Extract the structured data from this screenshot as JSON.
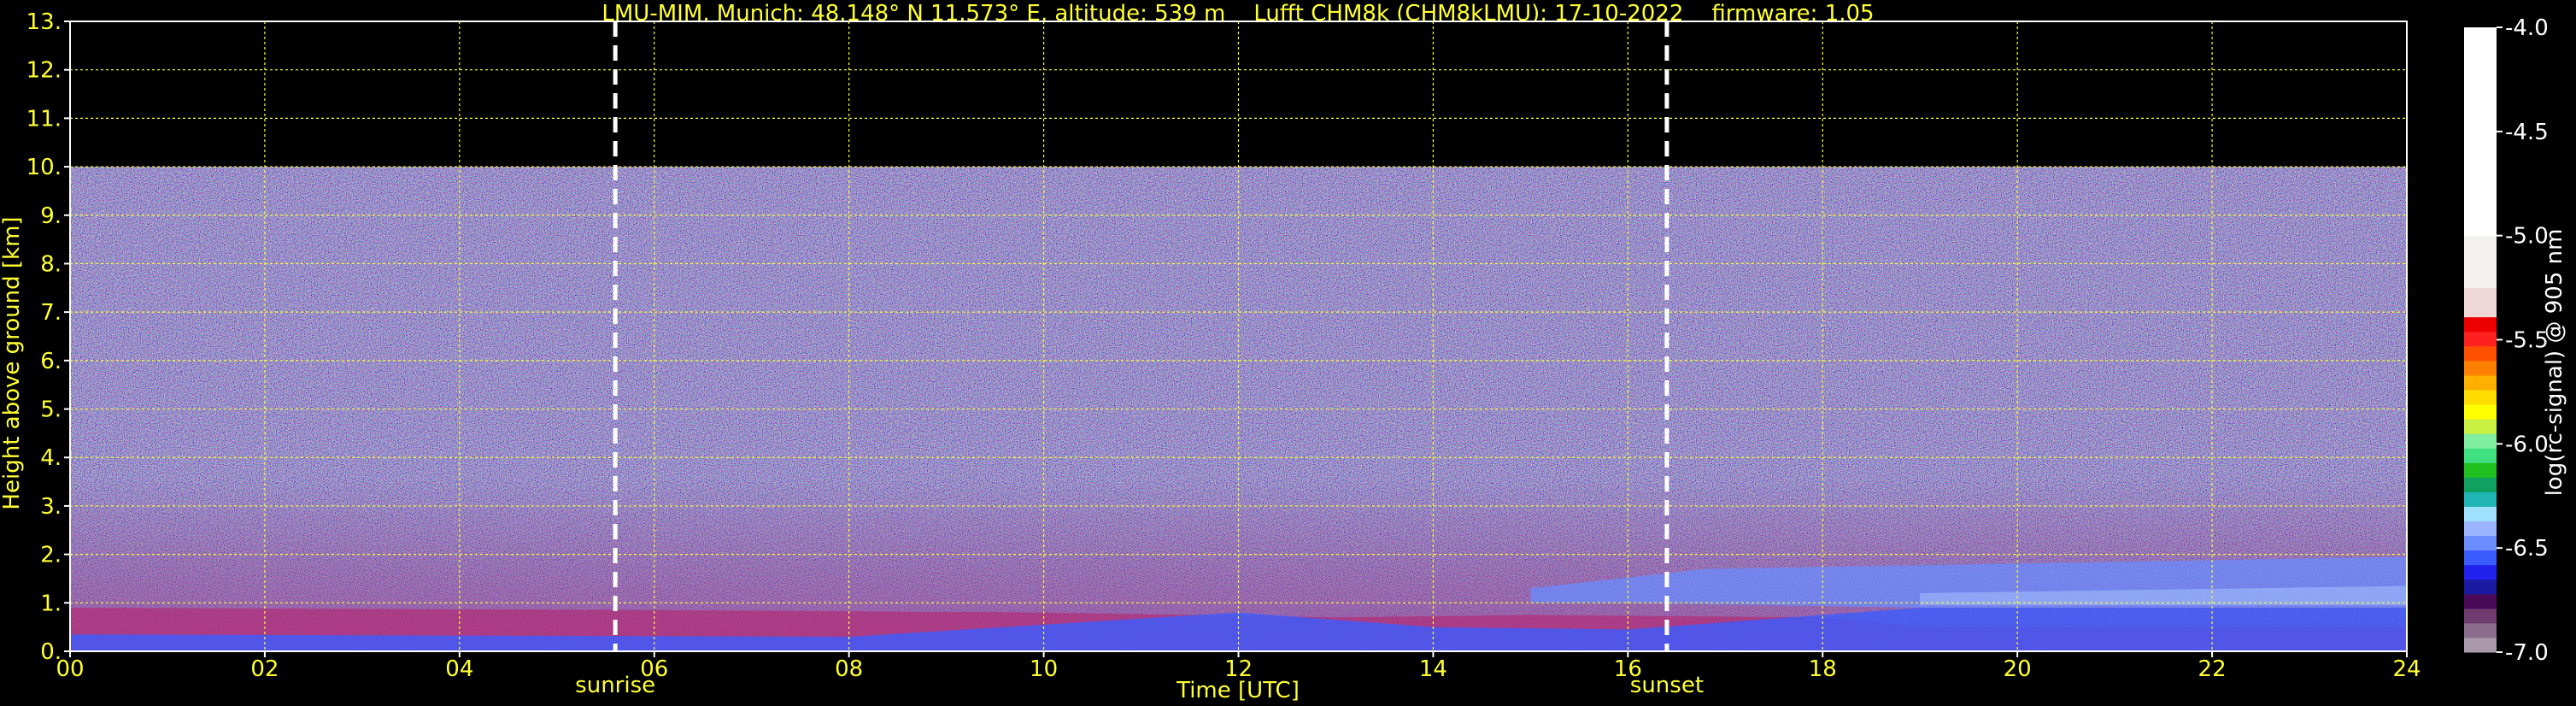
{
  "chart_data": {
    "type": "heatmap",
    "title": "LMU-MIM, Munich; 48.148° N 11.573° E, altitude: 539 m    Lufft CHM8k (CHM8kLMU): 17-10-2022    firmware: 1.05",
    "xlabel": "Time [UTC]",
    "ylabel": "Height above ground [km]",
    "xlim": [
      0,
      24
    ],
    "ylim": [
      0,
      13
    ],
    "x_ticks": [
      "00",
      "02",
      "04",
      "06",
      "08",
      "10",
      "12",
      "14",
      "16",
      "18",
      "20",
      "22",
      "24"
    ],
    "y_ticks": [
      "0.",
      "1.",
      "2.",
      "3.",
      "4.",
      "5.",
      "6.",
      "7.",
      "8.",
      "9.",
      "10.",
      "11.",
      "12.",
      "13."
    ],
    "grid": true,
    "data_max_height_km": 10,
    "events": [
      {
        "label": "sunrise",
        "time_h": 5.6
      },
      {
        "label": "sunset",
        "time_h": 16.4
      }
    ],
    "colorbar": {
      "label": "log(rc-signal) @ 905 nm",
      "range": [
        -7.0,
        -4.0
      ],
      "ticks": [
        "-4.0",
        "-4.5",
        "-5.0",
        "-5.5",
        "-6.0",
        "-6.5",
        "-7.0"
      ],
      "colors": [
        {
          "from": -7.0,
          "to": -6.93,
          "color": "#aa99aa"
        },
        {
          "from": -6.93,
          "to": -6.86,
          "color": "#8c6c8c"
        },
        {
          "from": -6.86,
          "to": -6.79,
          "color": "#6e3c6e"
        },
        {
          "from": -6.79,
          "to": -6.72,
          "color": "#4a0a5a"
        },
        {
          "from": -6.72,
          "to": -6.65,
          "color": "#1a1aa0"
        },
        {
          "from": -6.65,
          "to": -6.58,
          "color": "#2222ee"
        },
        {
          "from": -6.58,
          "to": -6.51,
          "color": "#3a5cff"
        },
        {
          "from": -6.51,
          "to": -6.44,
          "color": "#6a8cff"
        },
        {
          "from": -6.44,
          "to": -6.37,
          "color": "#9ab4ff"
        },
        {
          "from": -6.37,
          "to": -6.3,
          "color": "#a0e0ff"
        },
        {
          "from": -6.3,
          "to": -6.23,
          "color": "#20b4b4"
        },
        {
          "from": -6.23,
          "to": -6.16,
          "color": "#10a060"
        },
        {
          "from": -6.16,
          "to": -6.09,
          "color": "#20c020"
        },
        {
          "from": -6.09,
          "to": -6.02,
          "color": "#40e080"
        },
        {
          "from": -6.02,
          "to": -5.95,
          "color": "#80f0a0"
        },
        {
          "from": -5.95,
          "to": -5.88,
          "color": "#c8f040"
        },
        {
          "from": -5.88,
          "to": -5.81,
          "color": "#ffff00"
        },
        {
          "from": -5.81,
          "to": -5.74,
          "color": "#ffdd00"
        },
        {
          "from": -5.74,
          "to": -5.67,
          "color": "#ffb000"
        },
        {
          "from": -5.67,
          "to": -5.6,
          "color": "#ff8000"
        },
        {
          "from": -5.6,
          "to": -5.53,
          "color": "#ff5000"
        },
        {
          "from": -5.53,
          "to": -5.46,
          "color": "#ff2020"
        },
        {
          "from": -5.46,
          "to": -5.39,
          "color": "#ee0000"
        },
        {
          "from": -5.39,
          "to": -5.25,
          "color": "#f0d8d8"
        },
        {
          "from": -5.25,
          "to": -5.0,
          "color": "#f4f0f0"
        },
        {
          "from": -5.0,
          "to": -4.0,
          "color": "#ffffff"
        }
      ]
    }
  }
}
